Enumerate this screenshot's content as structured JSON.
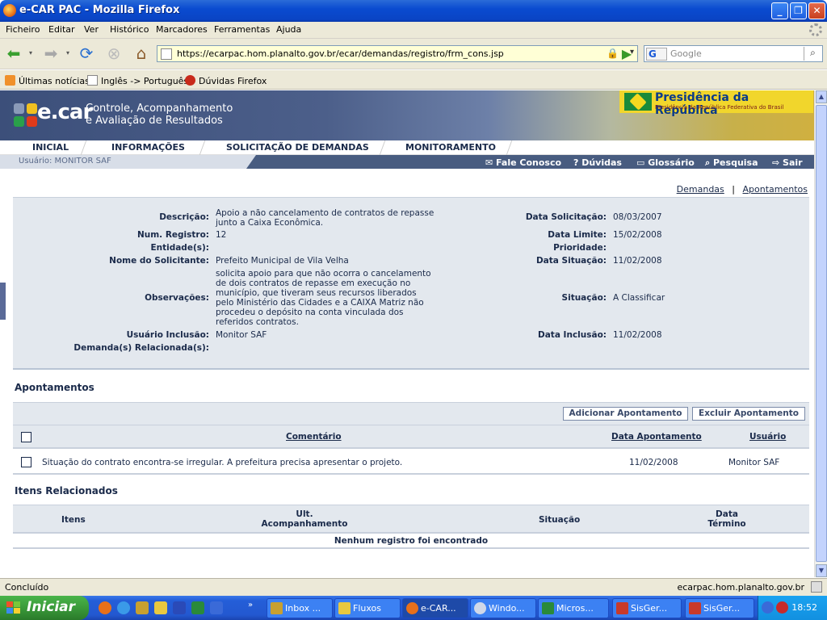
{
  "window": {
    "title": "e-CAR PAC - Mozilla Firefox"
  },
  "menu": [
    "Ficheiro",
    "Editar",
    "Ver",
    "Histórico",
    "Marcadores",
    "Ferramentas",
    "Ajuda"
  ],
  "toolbar": {
    "url": "https://ecarpac.hom.planalto.gov.br/ecar/demandas/registro/frm_cons.jsp",
    "search_placeholder": "Google",
    "search_engine_letter": "G"
  },
  "bookmarks": [
    "Últimas notícias",
    "Inglês -> Português",
    "Dúvidas Firefox"
  ],
  "banner": {
    "logo": "e.car",
    "tagline1": "Controle, Acompanhamento",
    "tagline2": "e Avaliação de Resultados",
    "presidencia_title": "Presidência da República",
    "presidencia_sub": "Presidência da República Federativa do Brasil"
  },
  "mainnav": [
    "INICIAL",
    "INFORMAÇÕES",
    "SOLICITAÇÃO DE DEMANDAS",
    "MONITORAMENTO"
  ],
  "subnav": {
    "user": "Usuário: MONITOR SAF",
    "links": [
      "Fale Conosco",
      "Dúvidas",
      "Glossário",
      "Pesquisa",
      "Sair"
    ]
  },
  "toplinks": {
    "demandas": "Demandas",
    "separator": "|",
    "apontamentos": "Apontamentos"
  },
  "details": {
    "descricao_label": "Descrição:",
    "descricao_line1": "Apoio a não cancelamento de contratos de repasse",
    "descricao_line2": "junto a Caixa Econômica.",
    "num_registro_label": "Num. Registro:",
    "num_registro": "12",
    "entidade_label": "Entidade(s):",
    "nome_solicitante_label": "Nome do Solicitante:",
    "nome_solicitante": "Prefeito Municipal de Vila Velha",
    "observacoes_label": "Observações:",
    "obs_lines": [
      "solicita apoio para que não ocorra o cancelamento",
      "de dois contratos de repasse em execução no",
      "município, que tiveram seus recursos liberados",
      "pelo Ministério das Cidades e a CAIXA Matriz não",
      "procedeu o depósito na conta vinculada dos",
      "referidos contratos."
    ],
    "usuario_inclusao_label": "Usuário Inclusão:",
    "usuario_inclusao": "Monitor SAF",
    "demandas_relacionadas_label": "Demanda(s) Relacionada(s):",
    "data_solicitacao_label": "Data Solicitação:",
    "data_solicitacao": "08/03/2007",
    "data_limite_label": "Data Limite:",
    "data_limite": "15/02/2008",
    "prioridade_label": "Prioridade:",
    "data_situacao_label": "Data Situação:",
    "data_situacao": "11/02/2008",
    "situacao_label": "Situação:",
    "situacao": "A Classificar",
    "data_inclusao_label": "Data Inclusão:",
    "data_inclusao": "11/02/2008"
  },
  "apontamentos": {
    "title": "Apontamentos",
    "add_button": "Adicionar Apontamento",
    "delete_button": "Excluir Apontamento",
    "headers": {
      "comentario": "Comentário",
      "data": "Data Apontamento",
      "usuario": "Usuário"
    },
    "rows": [
      {
        "comentario": "Situação do contrato encontra-se irregular. A prefeitura precisa apresentar o projeto.",
        "data": "11/02/2008",
        "usuario": "Monitor SAF"
      }
    ]
  },
  "itens": {
    "title": "Itens Relacionados",
    "headers": {
      "itens": "Itens",
      "ult1": "Ult.",
      "ult2": "Acompanhamento",
      "situacao": "Situação",
      "data1": "Data",
      "data2": "Término"
    },
    "empty": "Nenhum registro foi encontrado"
  },
  "status": {
    "left": "Concluído",
    "right": "ecarpac.hom.planalto.gov.br"
  },
  "taskbar": {
    "start": "Iniciar",
    "tasks": [
      "Inbox ...",
      "Fluxos",
      "e-CAR...",
      "Windo...",
      "Micros...",
      "SisGer...",
      "SisGer..."
    ],
    "clock": "18:52"
  }
}
